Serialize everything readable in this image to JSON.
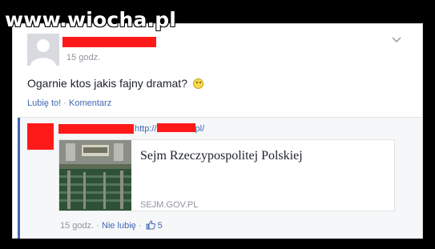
{
  "watermark": "www.wiocha.pl",
  "post": {
    "time": "15 godz.",
    "text": "Ogarnie ktos jakis fajny dramat?",
    "emoji": "smiley-emoji",
    "like_label": "Lubię to!",
    "separator": "·",
    "comment_label": "Komentarz"
  },
  "comment": {
    "link_prefix": "http://",
    "link_suffix": "pl/",
    "preview": {
      "title": "Sejm Rzeczypospolitej Polskiej",
      "domain": "SEJM.GOV.PL"
    },
    "time": "15 godz.",
    "separator": "·",
    "unlike_label": "Nie lubię",
    "like_icon": "thumbs-up-icon",
    "like_count": "5"
  },
  "colors": {
    "link": "#4267b2",
    "redaction": "#ff1a1a",
    "meta": "#90949c"
  }
}
